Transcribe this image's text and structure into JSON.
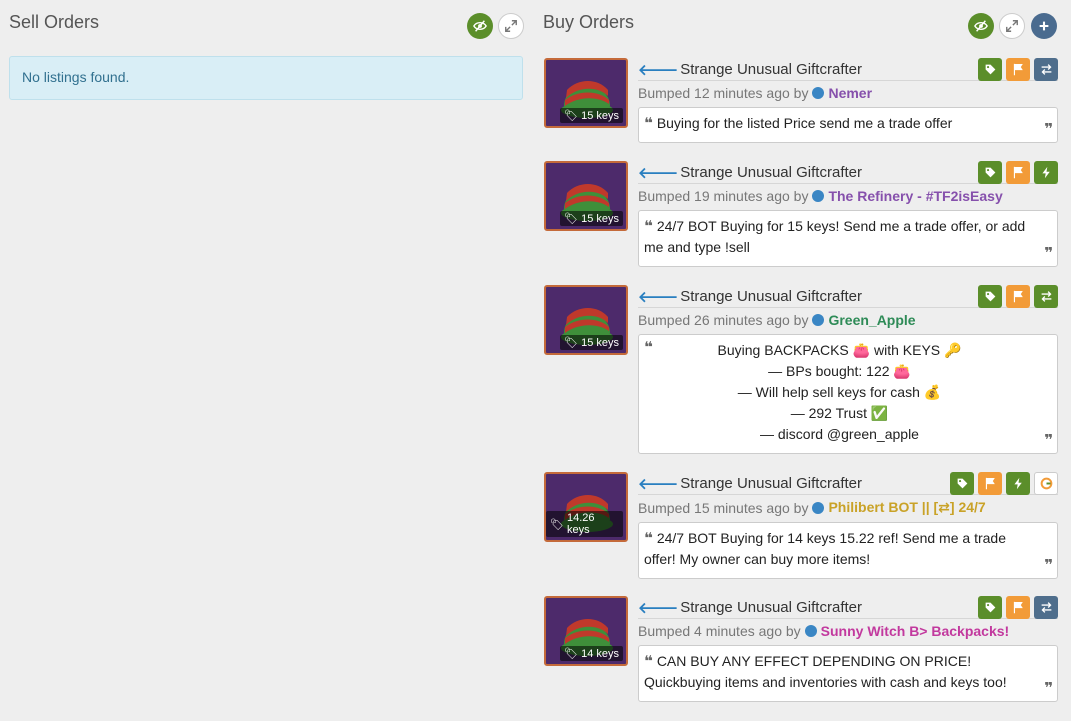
{
  "sell": {
    "title": "Sell Orders",
    "empty_message": "No listings found."
  },
  "buy": {
    "title": "Buy Orders"
  },
  "listings": [
    {
      "item": "Strange Unusual Giftcrafter",
      "price": "15 keys",
      "bumped": "Bumped 12 minutes ago by",
      "user": "Nemer",
      "user_color": "#8650ac",
      "comment": "Buying for the listed Price send me a trade offer"
    },
    {
      "item": "Strange Unusual Giftcrafter",
      "price": "15 keys",
      "bumped": "Bumped 19 minutes ago by",
      "user": "The Refinery - #TF2isEasy",
      "user_color": "#8650ac",
      "comment": "24/7 BOT Buying for 15 keys! Send me a trade offer, or add me and type !sell"
    },
    {
      "item": "Strange Unusual Giftcrafter",
      "price": "15 keys",
      "bumped": "Bumped 26 minutes ago by",
      "user": "Green_Apple",
      "user_color": "#2e8b57",
      "comment_lines": [
        "Buying BACKPACKS 👛 with KEYS 🔑",
        "— BPs bought: 122 👛",
        "— Will help sell keys for cash 💰",
        "— 292 Trust ✅",
        "— discord @green_apple"
      ]
    },
    {
      "item": "Strange Unusual Giftcrafter",
      "price": "14.26 keys",
      "bumped": "Bumped 15 minutes ago by",
      "user": "Philibert BOT || [⇄] 24/7",
      "user_color": "#c9a227",
      "comment": "24/7 BOT Buying for 14 keys 15.22 ref! Send me a trade offer! My owner can buy more items!"
    },
    {
      "item": "Strange Unusual Giftcrafter",
      "price": "14 keys",
      "bumped": "Bumped 4 minutes ago by",
      "user": "Sunny Witch B> Backpacks!",
      "user_color": "#c2399e",
      "comment": "CAN BUY ANY EFFECT DEPENDING ON PRICE! Quickbuying items and inventories with cash and keys too!"
    }
  ]
}
